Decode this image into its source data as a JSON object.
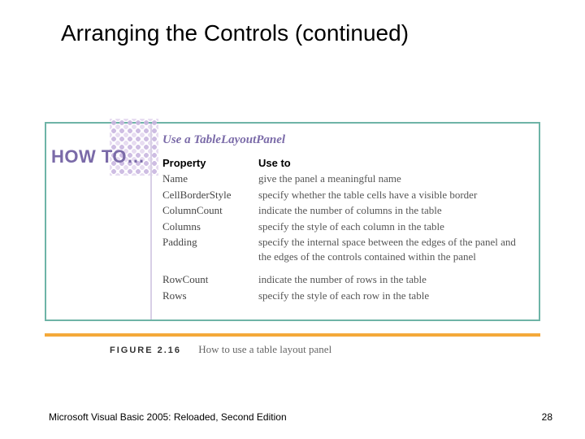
{
  "title": "Arranging the Controls (continued)",
  "howto": {
    "label": "HOW TO…",
    "subtitle": "Use a TableLayoutPanel",
    "headers": {
      "property": "Property",
      "use": "Use to"
    },
    "rows": [
      {
        "property": "Name",
        "use": "give the panel a meaningful name"
      },
      {
        "property": "CellBorderStyle",
        "use": "specify whether the table cells have a visible border"
      },
      {
        "property": "ColumnCount",
        "use": "indicate the number of columns in the table"
      },
      {
        "property": "Columns",
        "use": "specify the style of each column in the table"
      },
      {
        "property": "Padding",
        "use": "specify the internal space between the edges of the panel and the edges of the controls contained within the panel"
      },
      {
        "property": "RowCount",
        "use": "indicate the number of rows in the table"
      },
      {
        "property": "Rows",
        "use": "specify the style of each row in the table"
      }
    ]
  },
  "figure": {
    "label": "FIGURE 2.16",
    "caption": "How to use a table layout panel"
  },
  "footer": {
    "left": "Microsoft Visual Basic 2005: Reloaded, Second Edition",
    "page": "28"
  }
}
